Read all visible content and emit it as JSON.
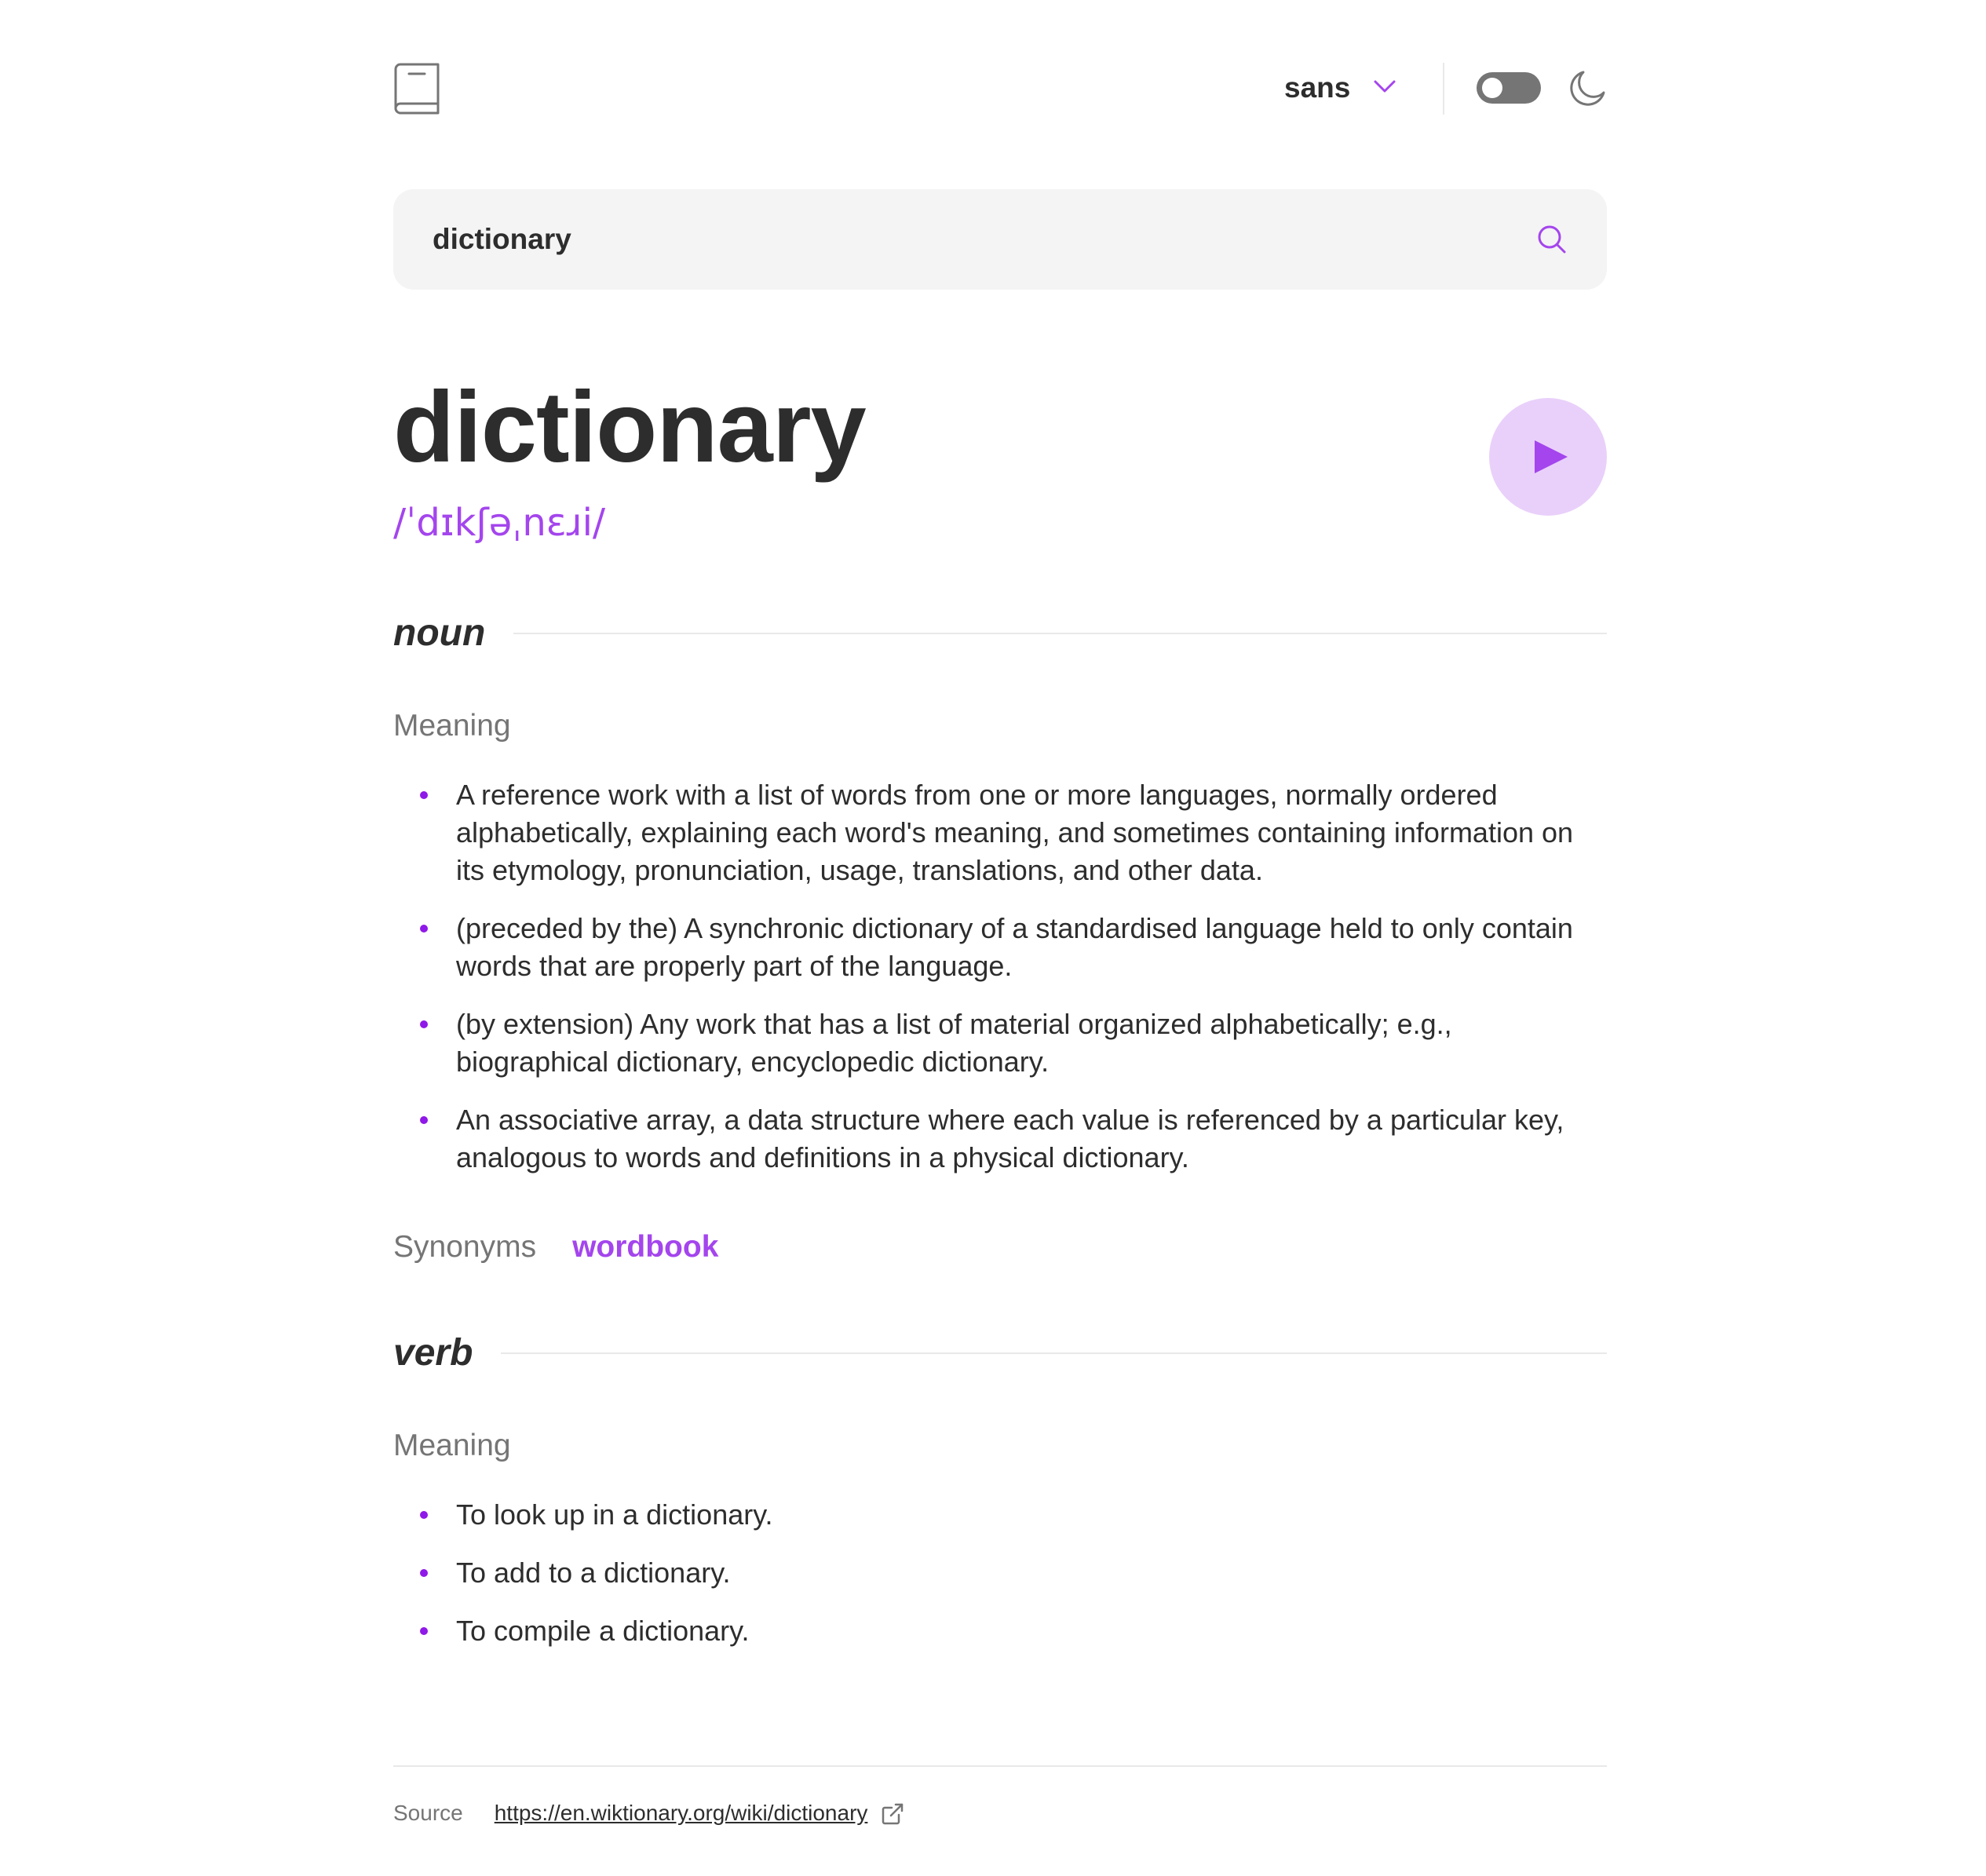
{
  "header": {
    "font_select": {
      "value": "sans"
    },
    "theme_toggle": {
      "dark_mode": false
    }
  },
  "search": {
    "value": "dictionary",
    "placeholder": ""
  },
  "entry": {
    "word": "dictionary",
    "phonetic": "/ˈdɪkʃəˌnɛɹi/",
    "meanings": [
      {
        "part_of_speech": "noun",
        "heading": "Meaning",
        "definitions": [
          "A reference work with a list of words from one or more languages, normally ordered alphabetically, explaining each word's meaning, and sometimes containing information on its etymology, pronunciation, usage, translations, and other data.",
          "(preceded by the) A synchronic dictionary of a standardised language held to only contain words that are properly part of the language.",
          "(by extension) Any work that has a list of material organized alphabetically; e.g., biographical dictionary, encyclopedic dictionary.",
          "An associative array, a data structure where each value is referenced by a particular key, analogous to words and definitions in a physical dictionary."
        ],
        "synonyms_label": "Synonyms",
        "synonyms": [
          "wordbook"
        ]
      },
      {
        "part_of_speech": "verb",
        "heading": "Meaning",
        "definitions": [
          "To look up in a dictionary.",
          "To add to a dictionary.",
          "To compile a dictionary."
        ]
      }
    ]
  },
  "footer": {
    "source_label": "Source",
    "source_url": "https://en.wiktionary.org/wiki/dictionary"
  },
  "icons": {
    "logo": "book-icon",
    "dropdown": "chevron-down-icon",
    "theme": "moon-icon",
    "search": "search-icon",
    "play": "play-icon",
    "external": "external-link-icon"
  },
  "colors": {
    "accent": "#a445ed",
    "accent_light": "#e9d0fa",
    "text": "#2d2d2d",
    "muted": "#757575",
    "search_bg": "#f4f4f4"
  }
}
